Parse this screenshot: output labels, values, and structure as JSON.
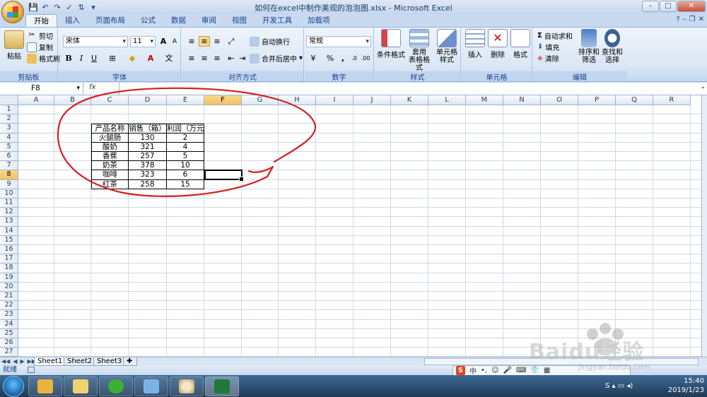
{
  "window": {
    "title": "如何在excel中制作美观的泡泡图.xlsx - Microsoft Excel"
  },
  "ribbon_tabs": [
    "开始",
    "插入",
    "页面布局",
    "公式",
    "数据",
    "审阅",
    "视图",
    "开发工具",
    "加载项"
  ],
  "clipboard": {
    "paste": "粘贴",
    "cut": "剪切",
    "copy": "复制",
    "format_painter": "格式刷",
    "label": "剪贴板"
  },
  "font": {
    "name": "宋体",
    "size": "11",
    "label": "字体",
    "bold": "B",
    "italic": "I",
    "underline": "U",
    "grow": "A",
    "shrink": "A"
  },
  "alignment": {
    "wrap": "自动换行",
    "merge": "合并后居中",
    "label": "对齐方式"
  },
  "number": {
    "format": "常规",
    "percent": "%",
    "comma": ",",
    "label": "数字"
  },
  "styles": {
    "conditional": "条件格式",
    "table": "套用\n表格格式",
    "cell": "单元格\n样式",
    "label": "样式"
  },
  "cells": {
    "insert": "插入",
    "delete": "删除",
    "format": "格式",
    "label": "单元格"
  },
  "editing": {
    "autosum": "自动求和",
    "fill": "填充",
    "clear": "清除",
    "sort": "排序和\n筛选",
    "find": "查找和\n选择",
    "label": "编辑"
  },
  "formula_bar": {
    "name_box": "F8",
    "fx": "fx",
    "formula": ""
  },
  "columns": [
    "A",
    "B",
    "C",
    "D",
    "E",
    "F",
    "G",
    "H",
    "I",
    "J",
    "K",
    "L",
    "M",
    "N",
    "O",
    "P",
    "Q",
    "R"
  ],
  "rows": [
    "1",
    "2",
    "3",
    "4",
    "5",
    "6",
    "7",
    "8",
    "9",
    "10",
    "11",
    "12",
    "13",
    "14",
    "15",
    "16",
    "17",
    "18",
    "19",
    "20",
    "21",
    "22",
    "23",
    "24",
    "25",
    "26",
    "27"
  ],
  "table": {
    "headers": [
      "产品名称",
      "销售（箱）",
      "利润（万元）"
    ],
    "rows": [
      [
        "火腿肠",
        "130",
        "2"
      ],
      [
        "酸奶",
        "321",
        "4"
      ],
      [
        "香蕉",
        "257",
        "5"
      ],
      [
        "奶茶",
        "378",
        "10"
      ],
      [
        "咖啡",
        "323",
        "6"
      ],
      [
        "红茶",
        "258",
        "15"
      ]
    ]
  },
  "sheets": [
    "Sheet1",
    "Sheet2",
    "Sheet3"
  ],
  "status": {
    "text": "就绪"
  },
  "ime": {
    "logo": "S",
    "mode": "中"
  },
  "tray": {
    "time": "15:40",
    "date": "2019/1/23"
  },
  "watermark": {
    "brand": "Baidu经验",
    "url": "jingyan.baidu.com"
  },
  "colors": {
    "annotation": "#d42020",
    "selected_header": "#f1c15f",
    "ribbon": "#dbe7f5",
    "taskbar": "#1e3a58"
  }
}
